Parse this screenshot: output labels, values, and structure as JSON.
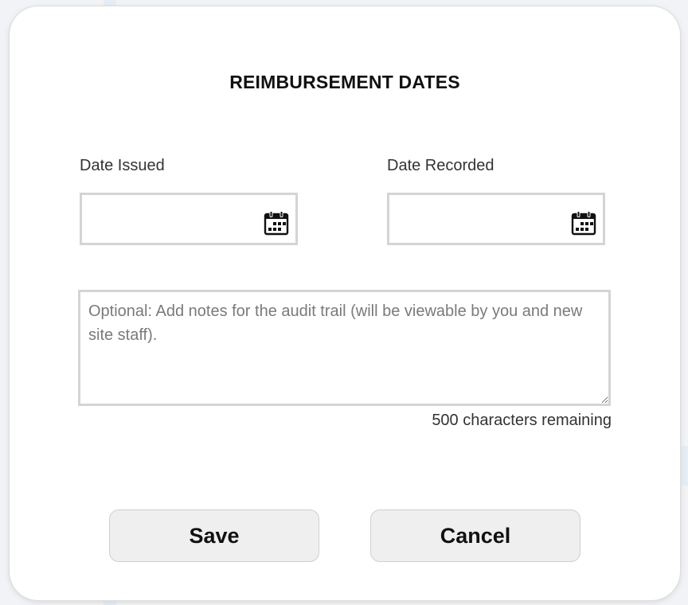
{
  "dialog": {
    "title": "REIMBURSEMENT DATES",
    "date_issued": {
      "label": "Date Issued",
      "value": "",
      "icon": "calendar-icon"
    },
    "date_recorded": {
      "label": "Date Recorded",
      "value": "",
      "icon": "calendar-icon"
    },
    "notes": {
      "placeholder": "Optional: Add notes for the audit trail (will be viewable by you and new site staff).",
      "value": ""
    },
    "remaining_text": "500 characters remaining",
    "save_label": "Save",
    "cancel_label": "Cancel"
  },
  "colors": {
    "backdrop": "#f1f3f6",
    "modal_background": "#ffffff",
    "input_border": "#d4d4d4",
    "button_background": "#efefef",
    "text": "#111111"
  }
}
